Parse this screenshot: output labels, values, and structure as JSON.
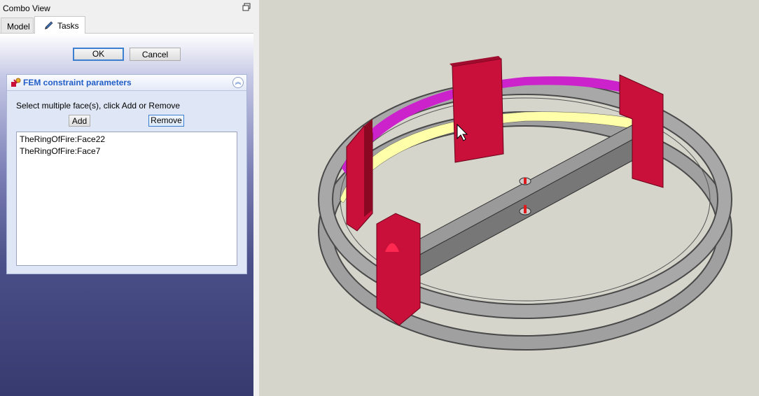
{
  "combo": {
    "title": "Combo View",
    "float_icon": "float-window-icon",
    "tabs": [
      {
        "label": "Model",
        "active": false
      },
      {
        "label": "Tasks",
        "active": true,
        "icon": "pencil-icon"
      }
    ]
  },
  "task": {
    "ok_label": "OK",
    "cancel_label": "Cancel",
    "group_title": "FEM constraint parameters",
    "group_icon": "fem-constraint-icon",
    "collapse_icon": "collapse-up-icon",
    "instruction": "Select multiple face(s), click Add or Remove",
    "add_label": "Add",
    "remove_label": "Remove",
    "faces": [
      "TheRingOfFire:Face22",
      "TheRingOfFire:Face7"
    ]
  },
  "viewport": {
    "background": "#d5d5cb",
    "model_colors": {
      "ring": "#9c9c9c",
      "constraint": "#c8103a",
      "magenta": "#cc22cc",
      "yellow": "#ffffaa"
    },
    "cursor_icon": "mouse-pointer-icon"
  }
}
